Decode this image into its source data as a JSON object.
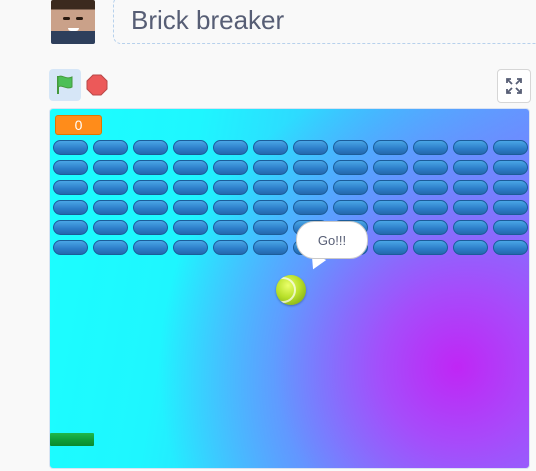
{
  "project": {
    "title": "Brick breaker"
  },
  "controls": {
    "green_flag_icon": "green-flag-icon",
    "stop_icon": "stop-sign-icon",
    "fullscreen_icon": "fullscreen-icon"
  },
  "stage": {
    "score": "0",
    "speech_bubble": "Go!!!",
    "brick_rows": 6,
    "brick_columns": 12,
    "colors": {
      "score_orange": "#ff8c1a",
      "brick_blue": "#2c7dc8",
      "paddle_green": "#0fa03a",
      "cyan": "#1bffff",
      "purple": "#c026f5"
    }
  }
}
